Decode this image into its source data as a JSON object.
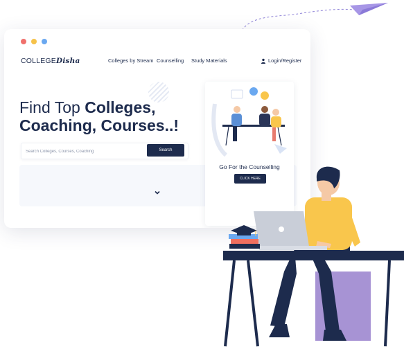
{
  "colors": {
    "navy": "#1d2b4d",
    "dot_red": "#f0706c",
    "dot_yellow": "#f6c24a",
    "dot_blue": "#6aa8f0",
    "person_yellow": "#f9c64c",
    "desk_purple": "#a793d4"
  },
  "logo": {
    "prefix": "COLLEGE",
    "suffix": "Disha"
  },
  "nav": {
    "items": [
      "Colleges by Stream",
      "Counselling",
      "Study Materials"
    ],
    "login_label": "Login/Register"
  },
  "hero": {
    "title_normal": "Find Top ",
    "title_bold_1": "Colleges,",
    "title_line2": "Coaching, Courses..!"
  },
  "search": {
    "placeholder": "Search Colleges, Courses, Coaching",
    "button_label": "Search"
  },
  "card": {
    "title": "Go For the Counselling",
    "button_label": "CLICK HERE"
  },
  "icons": [
    "user-icon",
    "chevron-down-icon",
    "paper-plane-icon",
    "graduation-cap-icon",
    "laptop-icon"
  ]
}
